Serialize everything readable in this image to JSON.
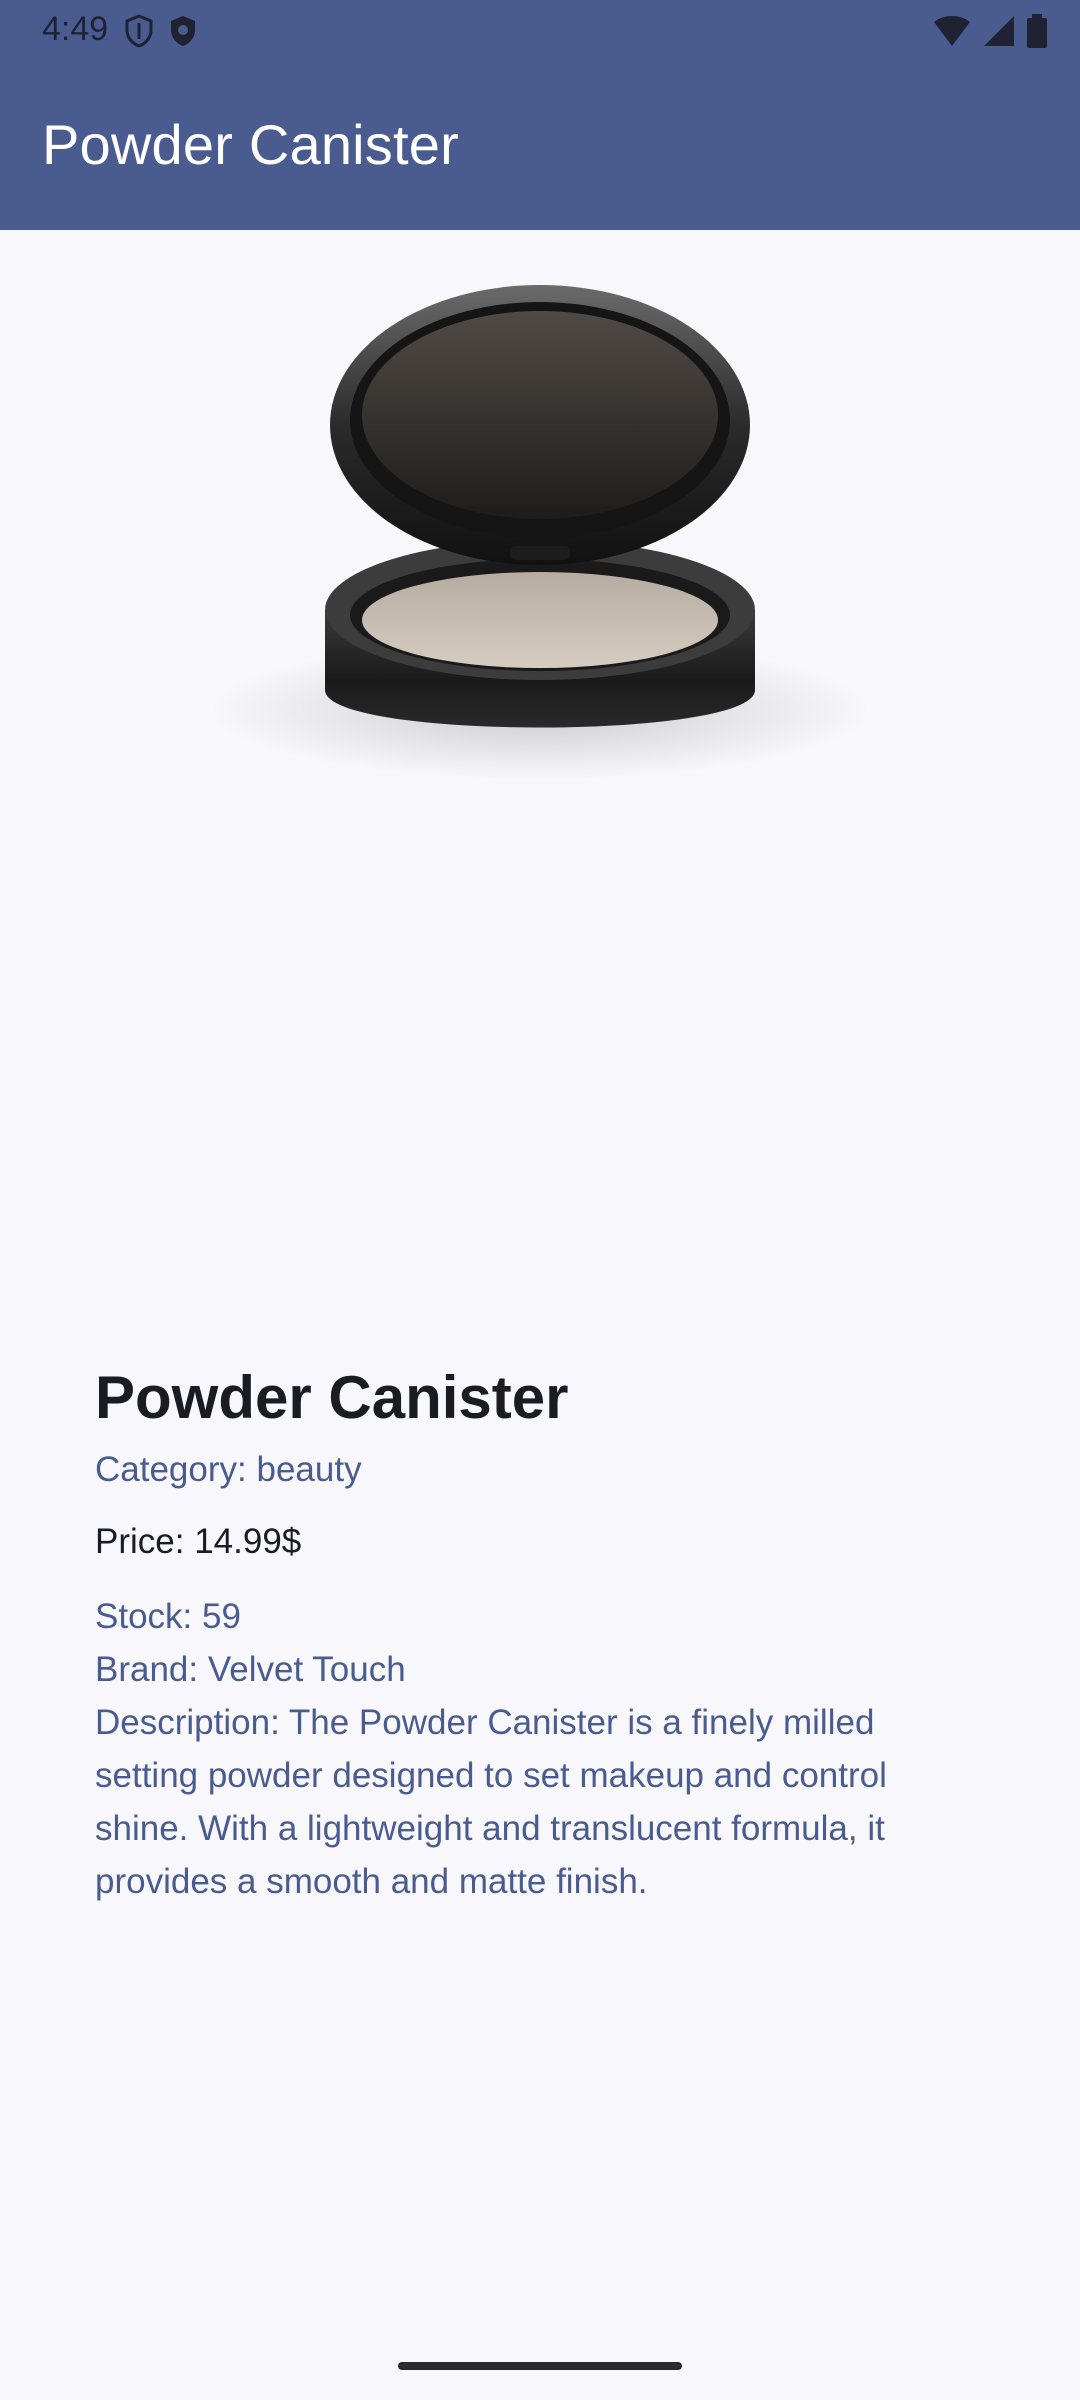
{
  "status_bar": {
    "time": "4:49",
    "icons_left": [
      "shield-icon",
      "shield-solid-icon"
    ],
    "icons_right": [
      "wifi-icon",
      "cellular-signal-icon",
      "battery-icon"
    ]
  },
  "app_bar": {
    "title": "Powder Canister"
  },
  "product": {
    "name": "Powder Canister",
    "category_label": "Category:",
    "category_value": "beauty",
    "price_label": "Price:",
    "price_value": "14.99$",
    "stock_label": "Stock:",
    "stock_value": "59",
    "brand_label": "Brand:",
    "brand_value": "Velvet Touch",
    "description_label": "Description:",
    "description_value": "The Powder Canister is a finely milled setting powder designed to set makeup and control shine. With a lightweight and translucent formula, it provides a smooth and matte finish."
  },
  "colors": {
    "app_bar": "#4a5b8f",
    "background": "#f7f7fc",
    "accent_text": "#4a5b8f",
    "primary_text": "#1b1c22"
  }
}
